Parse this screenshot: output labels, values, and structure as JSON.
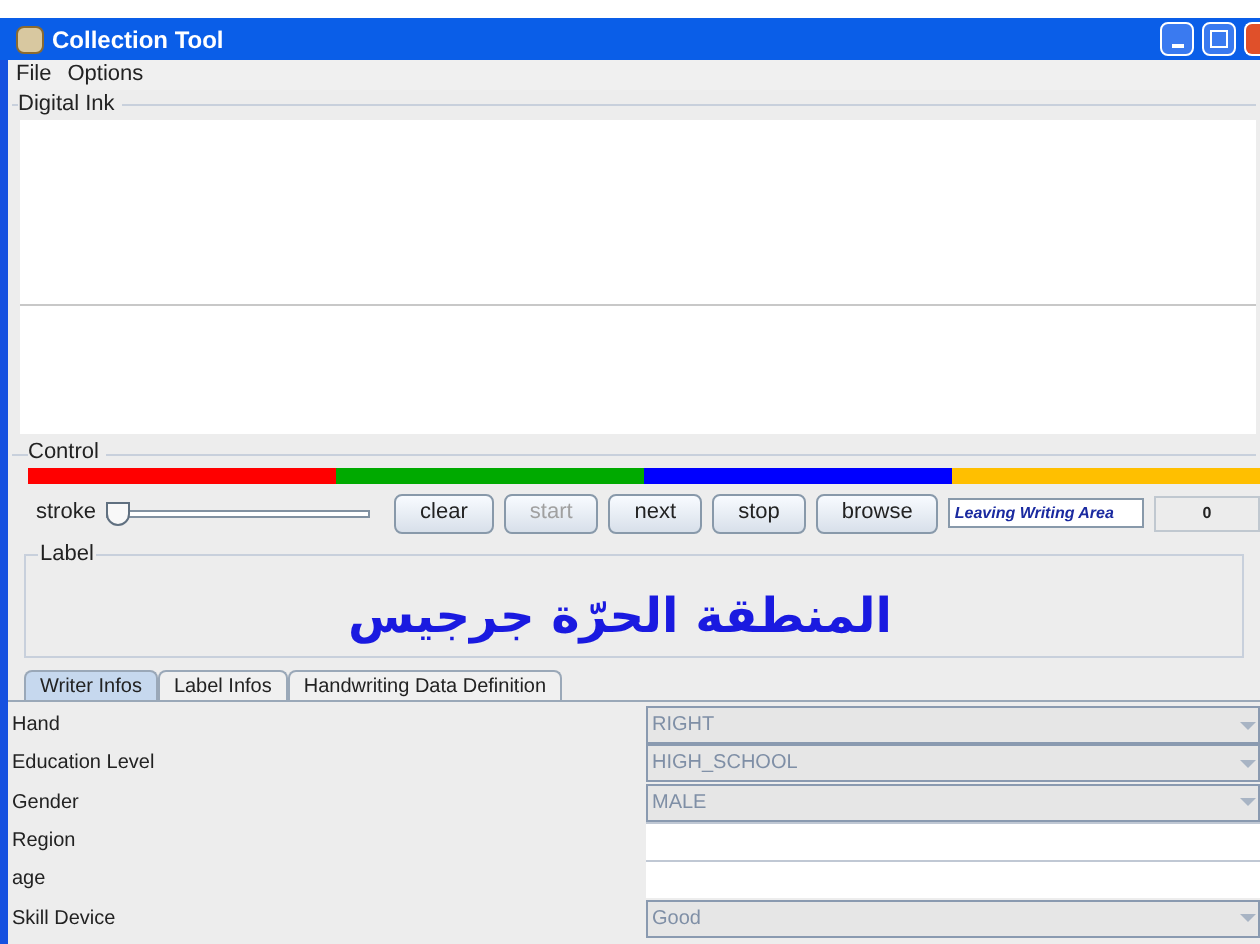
{
  "window": {
    "title": "Collection Tool"
  },
  "menu": [
    "File",
    "Options"
  ],
  "digital_ink": {
    "title": "Digital Ink"
  },
  "control": {
    "title": "Control",
    "color_bars": [
      {
        "color": "#ff0000"
      },
      {
        "color": "#00aa00"
      },
      {
        "color": "#0000ff"
      },
      {
        "color": "#ffbf00"
      }
    ],
    "stroke": {
      "label": "stroke",
      "level": 0
    },
    "buttons": [
      {
        "label": "clear",
        "disabled": false
      },
      {
        "label": "start",
        "disabled": true
      },
      {
        "label": "next",
        "disabled": false
      },
      {
        "label": "stop",
        "disabled": false
      },
      {
        "label": "browse",
        "disabled": false
      }
    ],
    "status": "Leaving Writing Area",
    "counter": "0"
  },
  "label": {
    "title": "Label",
    "text": "المنطقة الحرّة جرجيس"
  },
  "tabs": [
    {
      "label": "Writer Infos",
      "selected": true
    },
    {
      "label": "Label Infos",
      "selected": false
    },
    {
      "label": "Handwriting Data Definition",
      "selected": false
    }
  ],
  "fields": [
    {
      "label": "Hand",
      "kind": "combo",
      "value": "RIGHT"
    },
    {
      "label": "Education Level",
      "kind": "combo",
      "value": "HIGH_SCHOOL"
    },
    {
      "label": "Gender",
      "kind": "combo",
      "value": "MALE"
    },
    {
      "label": "Region",
      "kind": "text"
    },
    {
      "label": "age",
      "kind": "text"
    },
    {
      "label": "Skill Device",
      "kind": "combo",
      "value": "Good"
    }
  ]
}
